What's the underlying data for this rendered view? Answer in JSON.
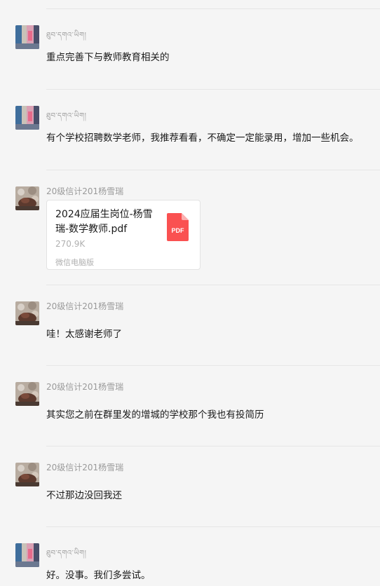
{
  "messages": [
    {
      "sender": "ཐུབ་དགའ་ཡིག།",
      "avatar": "teacher-avatar",
      "text": "重点完善下与教师教育相关的"
    },
    {
      "sender": "ཐུབ་དགའ་ཡིག།",
      "avatar": "teacher-avatar",
      "text": "有个学校招聘数学老师，我推荐看看，不确定一定能录用，增加一些机会。"
    },
    {
      "sender": "20级信计201杨雪瑞",
      "avatar": "student-avatar",
      "file": {
        "name": "2024应届生岗位-杨雪瑞-数学教师.pdf",
        "size": "270.9K",
        "source": "微信电脑版",
        "icon_label": "PDF",
        "icon_color": "#fa5151"
      }
    },
    {
      "sender": "20级信计201杨雪瑞",
      "avatar": "student-avatar",
      "text": "哇！太感谢老师了"
    },
    {
      "sender": "20级信计201杨雪瑞",
      "avatar": "student-avatar",
      "text": "其实您之前在群里发的增城的学校那个我也有投简历"
    },
    {
      "sender": "20级信计201杨雪瑞",
      "avatar": "student-avatar",
      "text": "不过那边没回我还"
    },
    {
      "sender": "ཐུབ་དགའ་ཡིག།",
      "avatar": "teacher-avatar",
      "text": "好。没事。我们多尝试。"
    }
  ]
}
